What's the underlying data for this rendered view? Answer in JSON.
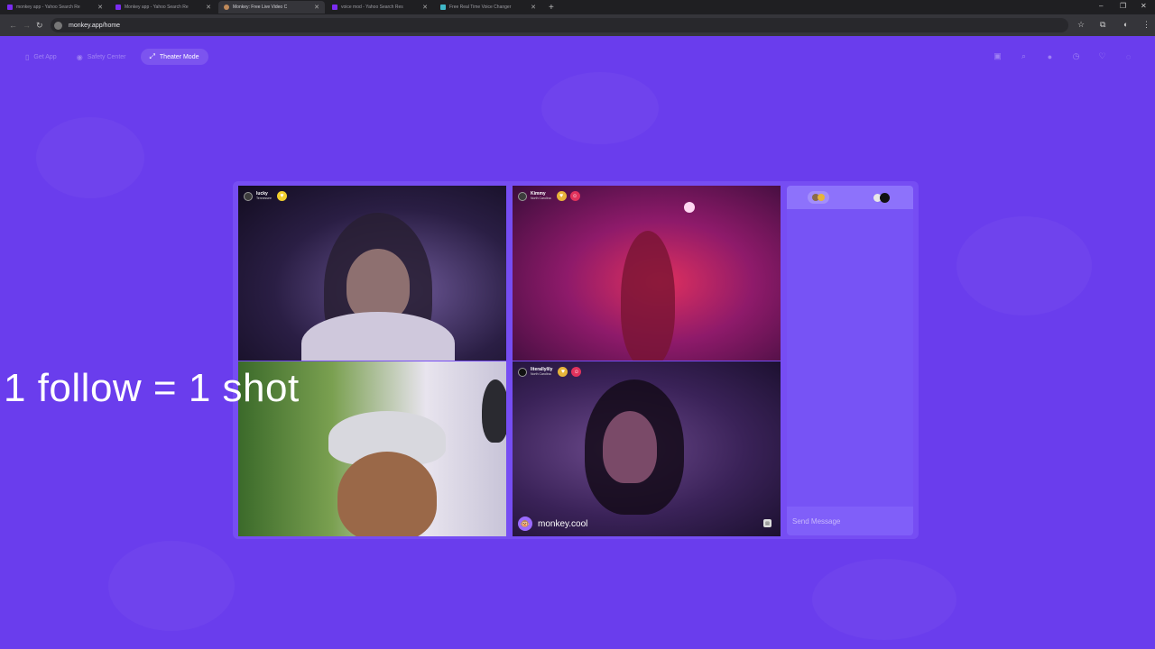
{
  "browser": {
    "tabs": [
      {
        "label": "monkey app - Yahoo Search Re",
        "favicon_color": "#7b2cf0",
        "active": false
      },
      {
        "label": "Monkey app - Yahoo Search Re",
        "favicon_color": "#7b2cf0",
        "active": false
      },
      {
        "label": "Monkey: Free Live Video C",
        "favicon_color": "#c08a5a",
        "active": true
      },
      {
        "label": "voice mod - Yahoo Search Res",
        "favicon_color": "#7b2cf0",
        "active": false
      },
      {
        "label": "Free Real Time Voice Changer",
        "favicon_color": "#3fb8c8",
        "active": false
      }
    ],
    "url": "monkey.app/home"
  },
  "nav": {
    "get_app": "Get App",
    "safety_center": "Safety Center",
    "theater_mode": "Theater Mode"
  },
  "tiles": [
    {
      "username": "lucky",
      "location": "Tennessee"
    },
    {
      "username": "Kimmy",
      "location": "North Carolina"
    },
    {
      "username": "",
      "location": ""
    },
    {
      "username": "literallylily",
      "location": "North Carolina"
    }
  ],
  "brand": {
    "name": "monkey.cool"
  },
  "chat": {
    "placeholder": "Send Message"
  },
  "overlay_text": "1 follow = 1 shot",
  "colors": {
    "page_bg": "#6a3ded",
    "accent": "#9b6bff",
    "heart": "#e7b43a",
    "badge": "#e1325c"
  },
  "icons": [
    "shop-icon",
    "search-icon",
    "coin-icon",
    "history-icon",
    "chat-icon",
    "profile-icon"
  ]
}
